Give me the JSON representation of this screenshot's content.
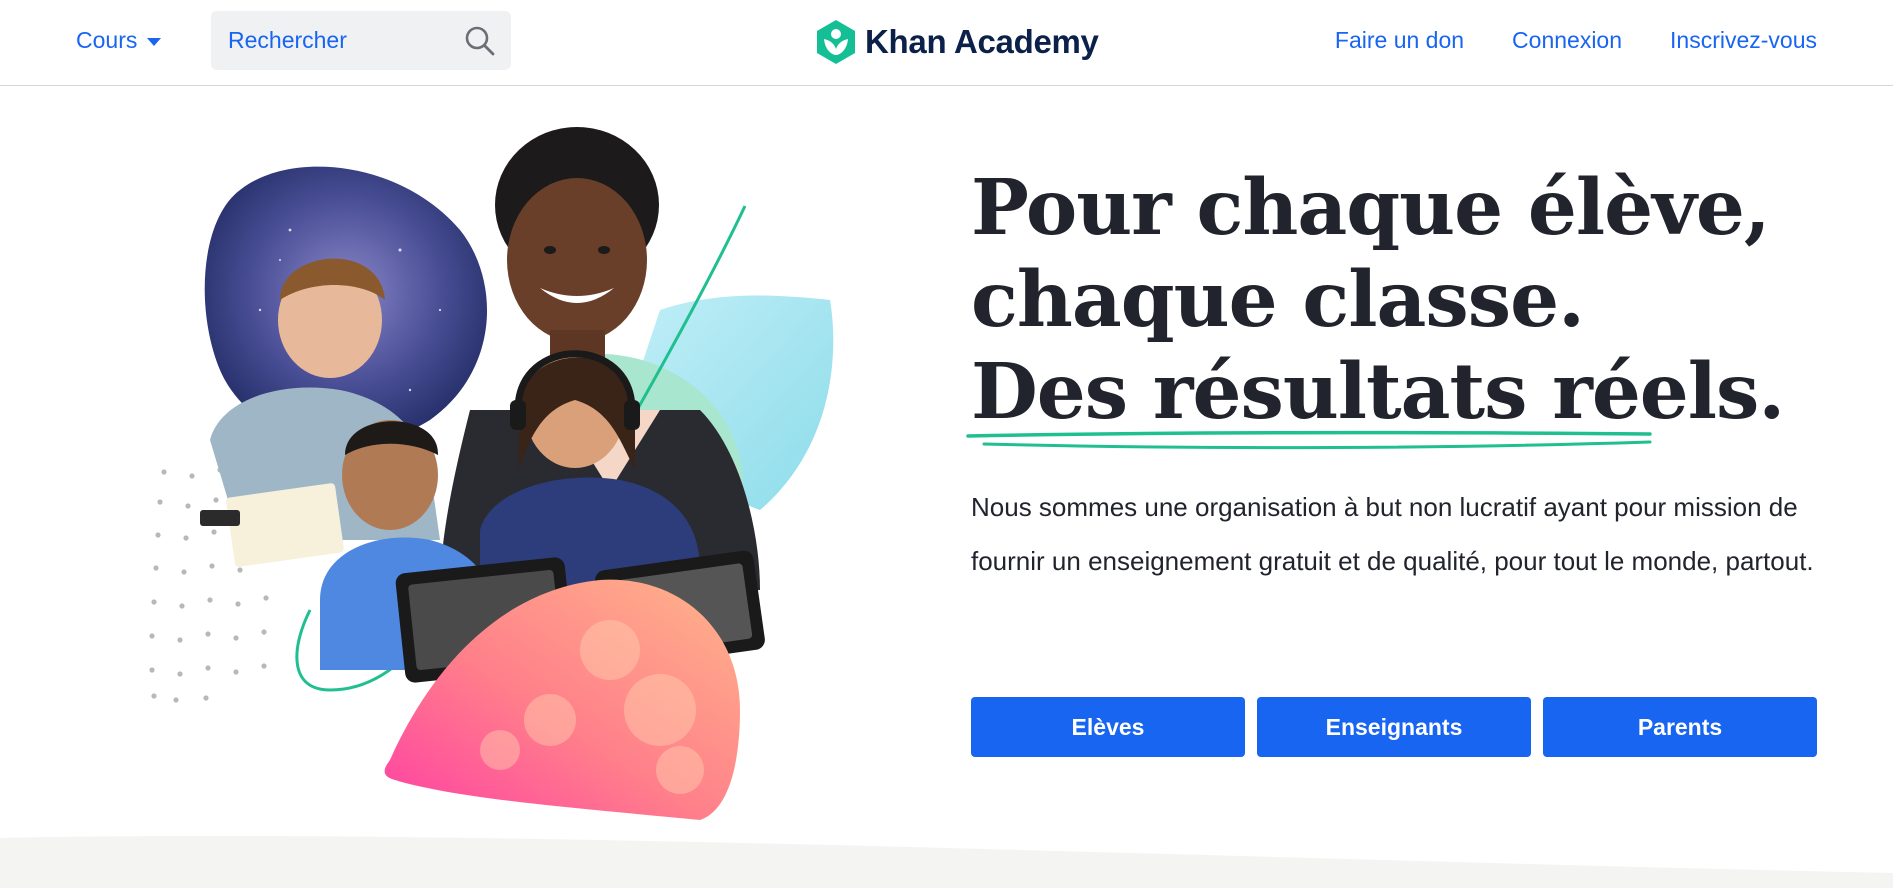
{
  "header": {
    "courses_label": "Cours",
    "search_placeholder": "Rechercher",
    "brand": "Khan Academy",
    "nav": {
      "donate": "Faire un don",
      "login": "Connexion",
      "signup": "Inscrivez-vous"
    }
  },
  "hero": {
    "headline_line1": "Pour chaque élève,",
    "headline_line2": "chaque classe.",
    "headline_line3": "Des résultats réels.",
    "description": "Nous sommes une organisation à but non lucratif ayant pour mission de fournir un enseignement gratuit et de qualité, pour tout le monde, partout.",
    "buttons": {
      "students": "Elèves",
      "teachers": "Enseignants",
      "parents": "Parents"
    }
  },
  "colors": {
    "accent": "#1865f2",
    "brand_green": "#14bf96",
    "text": "#21242c",
    "brand_dark": "#0b2149"
  },
  "icons": {
    "search": "search-icon",
    "caret": "chevron-down-icon",
    "logo": "khan-academy-logo-icon"
  }
}
